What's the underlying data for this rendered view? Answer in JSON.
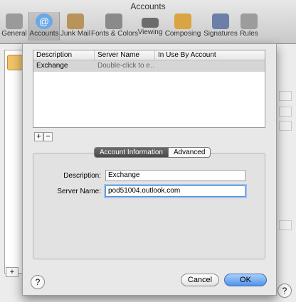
{
  "window": {
    "title": "Accounts"
  },
  "toolbar": {
    "items": [
      {
        "label": "General",
        "icon": "switch-icon",
        "color": "#9a9a9a"
      },
      {
        "label": "Accounts",
        "icon": "at-sign-icon",
        "color": "#6aa8e8"
      },
      {
        "label": "Junk Mail",
        "icon": "trash-bag-icon",
        "color": "#b8945a"
      },
      {
        "label": "Fonts & Colors",
        "icon": "fonts-icon",
        "color": "#8a8a8a"
      },
      {
        "label": "Viewing",
        "icon": "glasses-icon",
        "color": "#6c6c6c"
      },
      {
        "label": "Composing",
        "icon": "pencil-icon",
        "color": "#d9a441"
      },
      {
        "label": "Signatures",
        "icon": "signature-icon",
        "color": "#6b7fa8"
      },
      {
        "label": "Rules",
        "icon": "rules-icon",
        "color": "#9c9c9c"
      }
    ],
    "selected": "Accounts"
  },
  "server_table": {
    "headers": [
      "Description",
      "Server Name",
      "In Use By Account"
    ],
    "rows": [
      {
        "description": "Exchange",
        "server_name": "Double-click to e…",
        "in_use": ""
      }
    ]
  },
  "controls": {
    "add": "+",
    "remove": "−"
  },
  "tabs": {
    "account_information": "Account Information",
    "advanced": "Advanced",
    "selected": "Account Information"
  },
  "form": {
    "description_label": "Description:",
    "description_value": "Exchange",
    "server_label": "Server Name:",
    "server_value": "pod51004.outlook.com"
  },
  "buttons": {
    "help": "?",
    "cancel": "Cancel",
    "ok": "OK"
  }
}
